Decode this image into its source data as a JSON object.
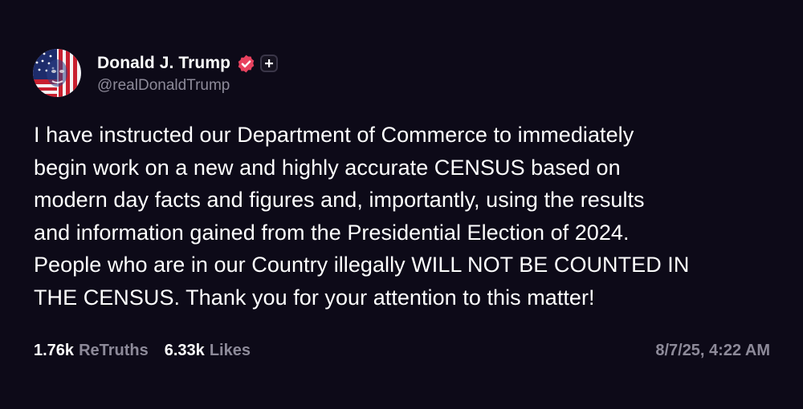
{
  "author": {
    "display_name": "Donald J. Trump",
    "handle": "@realDonaldTrump"
  },
  "post": {
    "text": "I have instructed our Department of Commerce to immediately begin work on a new and highly accurate CENSUS based on modern day facts and figures and, importantly, using the results and information gained from the Presidential Election of 2024. People who are in our Country illegally WILL NOT BE COUNTED IN THE CENSUS. Thank you for your attention to this matter!",
    "lines": [
      "I have instructed our Department of Commerce to immediately",
      "begin work on a new and highly accurate CENSUS based on",
      "modern day facts and figures and, importantly, using the results",
      "and information gained from the Presidential Election of 2024.",
      "People who are in our Country illegally WILL NOT BE COUNTED IN",
      "THE CENSUS. Thank you for your attention to this matter!"
    ]
  },
  "stats": {
    "retruths_count": "1.76k",
    "retruths_label": "ReTruths",
    "likes_count": "6.33k",
    "likes_label": "Likes"
  },
  "timestamp": "8/7/25, 4:22 AM",
  "colors": {
    "background": "#0d0a18",
    "text": "#ffffff",
    "muted": "#8d8a99",
    "verified_badge": "#e8425f"
  },
  "icons": {
    "verified": "verified-badge-icon",
    "plus": "plus-badge-icon"
  }
}
